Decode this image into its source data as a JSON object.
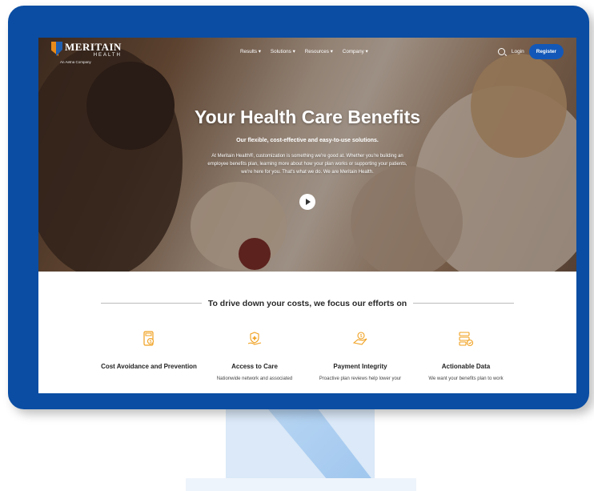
{
  "site": {
    "logo_name": "MERITAIN",
    "logo_sub": "HEALTH",
    "logo_tagline": "An Aetna Company"
  },
  "nav": {
    "menu": [
      {
        "label": "Results ▾"
      },
      {
        "label": "Solutions ▾"
      },
      {
        "label": "Resources ▾"
      },
      {
        "label": "Company ▾"
      }
    ],
    "login": "Login",
    "register": "Register"
  },
  "hero": {
    "title": "Your Health Care Benefits",
    "subtitle": "Our flexible, cost-effective and easy-to-use solutions.",
    "body": "At Meritain Health®, customization is something we're good at. Whether you're building an employee benefits plan, learning more about how your plan works or supporting your patients, we're here for you. That's what we do. We are Meritain Health."
  },
  "section": {
    "title": "To drive down your costs, we focus our efforts on"
  },
  "features": [
    {
      "title": "Cost Avoidance and Prevention",
      "desc": "",
      "icon": "calculator-dollar-icon"
    },
    {
      "title": "Access to Care",
      "desc": "Nationwide network and associated",
      "icon": "shield-hand-icon"
    },
    {
      "title": "Payment Integrity",
      "desc": "Proactive plan reviews help lower your",
      "icon": "dollar-hand-icon"
    },
    {
      "title": "Actionable Data",
      "desc": "We want your benefits plan to work",
      "icon": "data-list-check-icon"
    }
  ],
  "colors": {
    "monitor_frame": "#0a4da3",
    "register_button": "#1358b8",
    "icon_accent": "#f0a01e"
  }
}
